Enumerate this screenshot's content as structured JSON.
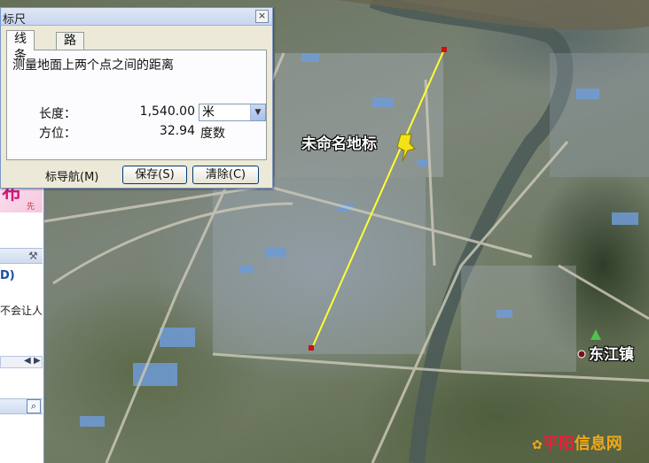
{
  "dialog": {
    "title": "标尺",
    "close_label": "×",
    "tabs": [
      {
        "label": "线条",
        "active": true
      },
      {
        "label": "路径",
        "active": false
      }
    ],
    "description": "测量地面上两个点之间的距离",
    "length_label": "长度：",
    "length_value": "1,540.00",
    "length_unit": "米",
    "heading_label": "方位：",
    "heading_value": "32.94",
    "heading_unit": "度数",
    "nav_checkbox_label": "标导航(M)",
    "save_button": "保存(S)",
    "clear_button": "清除(C)"
  },
  "side_window": {
    "minimize_label": "—",
    "close_label": "✕",
    "banner_big": "布",
    "banner_small": "先",
    "item_d": "D)",
    "text_line": "不会让人",
    "search_icon": "search-icon"
  },
  "map": {
    "placemark_label": "未命名地标",
    "town_label": "东江镇",
    "watermark_part1": "平阳",
    "watermark_part2": "信息网",
    "measure_line_color": "#ffff33",
    "endpoint_color": "#cc1111",
    "pushpin_color": "#f5e216"
  }
}
